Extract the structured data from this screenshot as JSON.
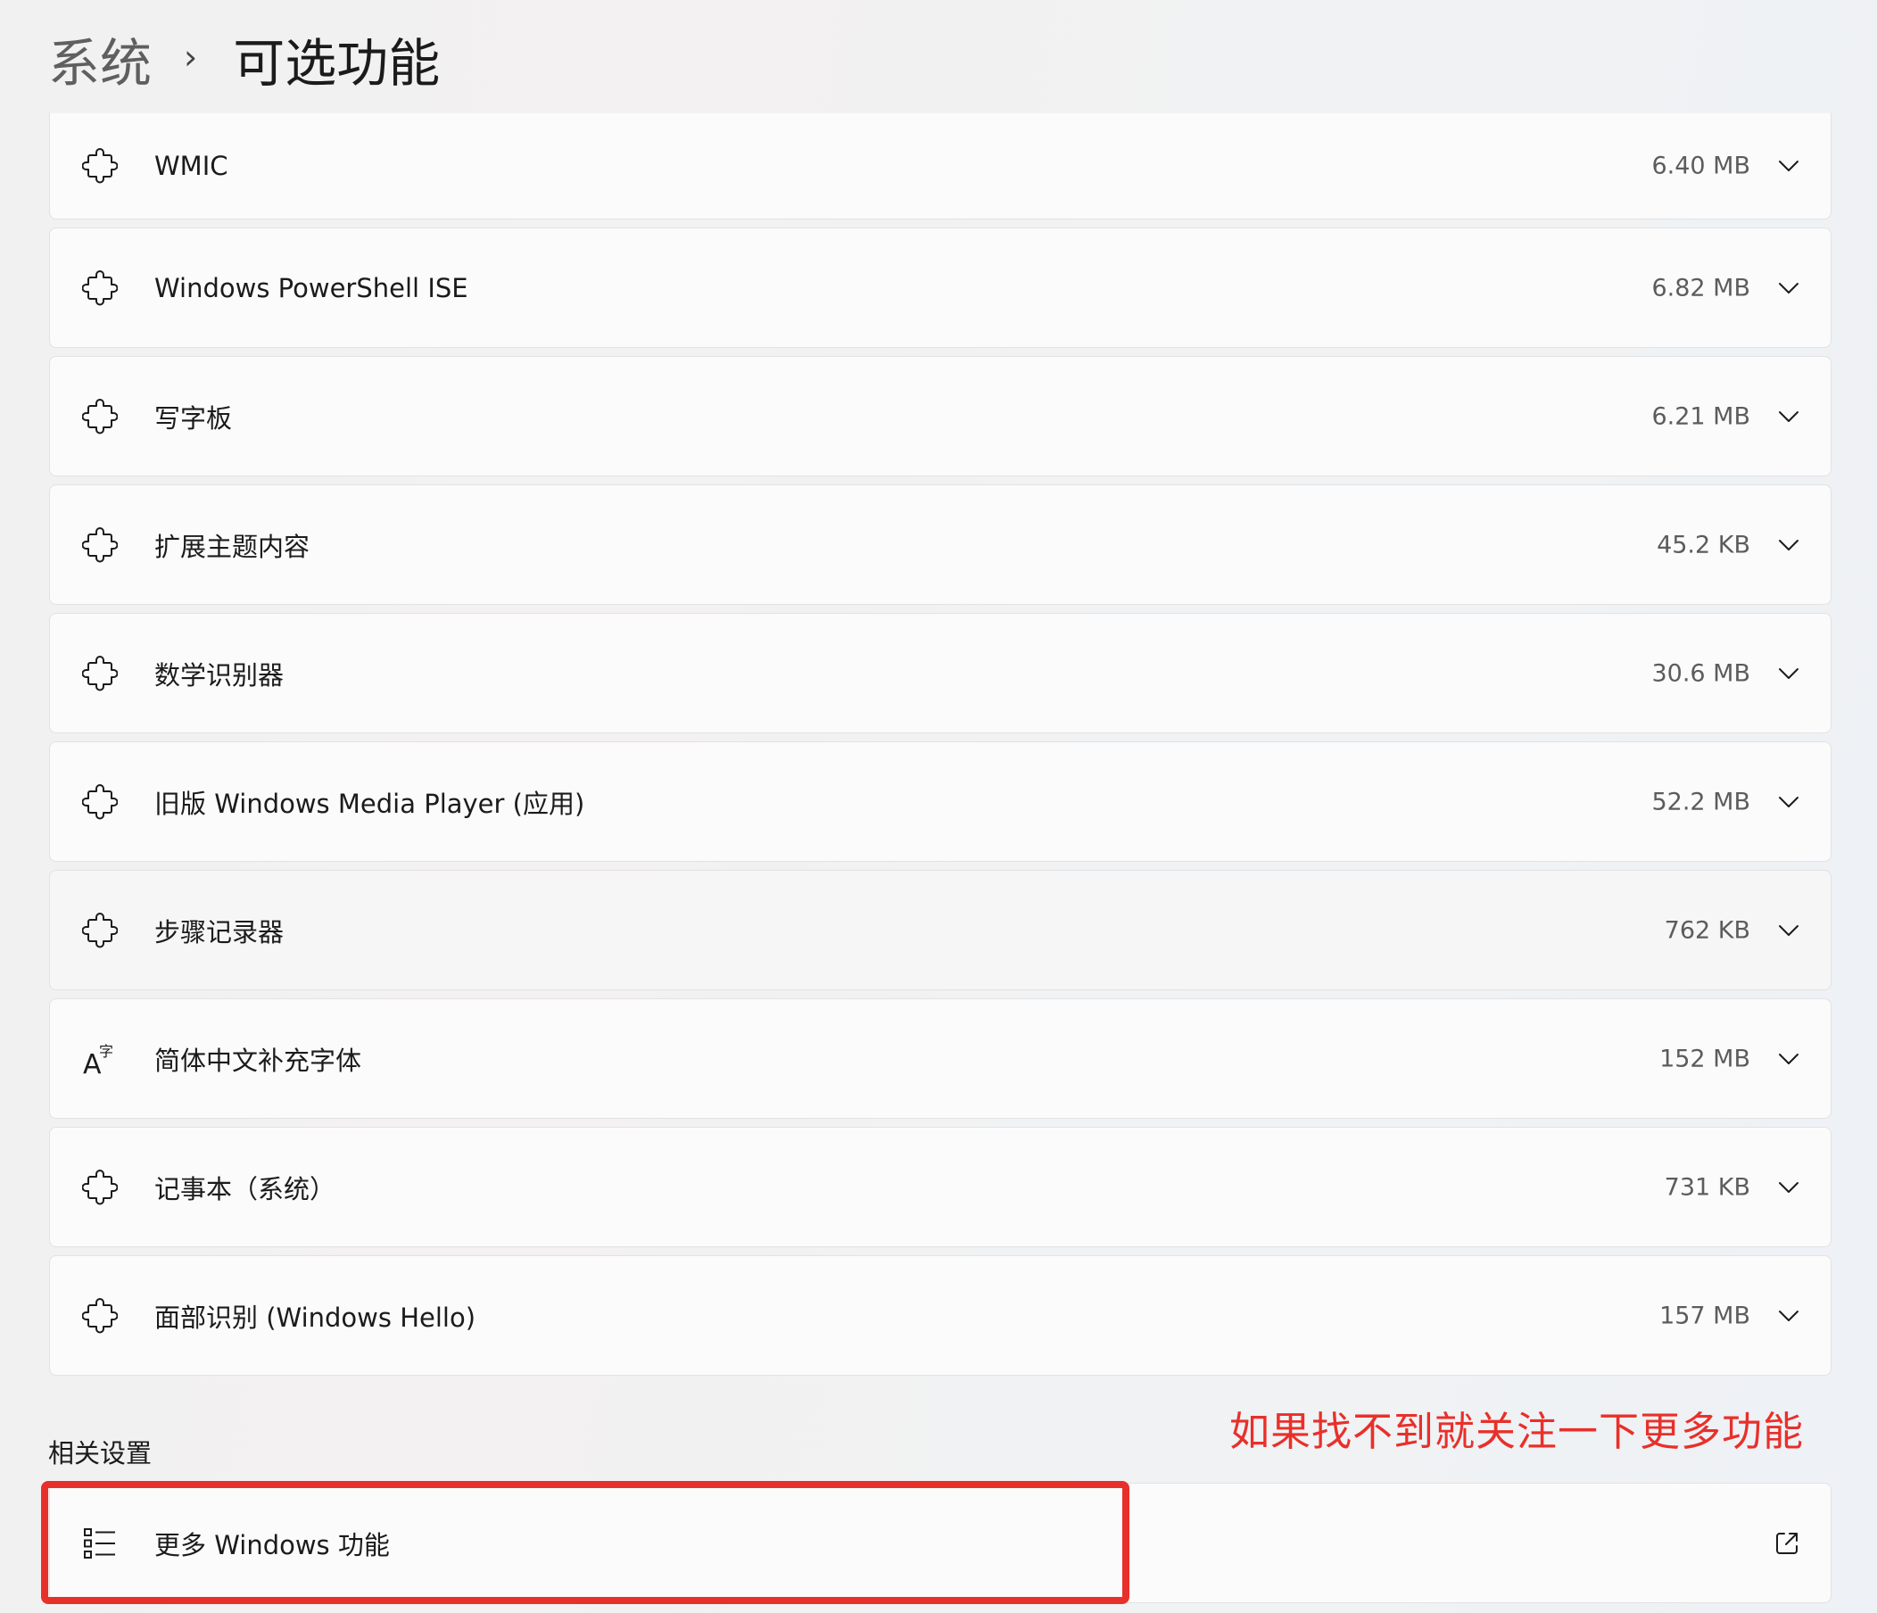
{
  "breadcrumb": {
    "parent": "系统",
    "separator": "›",
    "current": "可选功能"
  },
  "features": [
    {
      "name": "WMIC",
      "size": "6.40 MB",
      "icon": "puzzle-icon"
    },
    {
      "name": "Windows PowerShell ISE",
      "size": "6.82 MB",
      "icon": "puzzle-icon"
    },
    {
      "name": "写字板",
      "size": "6.21 MB",
      "icon": "puzzle-icon"
    },
    {
      "name": "扩展主题内容",
      "size": "45.2 KB",
      "icon": "puzzle-icon"
    },
    {
      "name": "数学识别器",
      "size": "30.6 MB",
      "icon": "puzzle-icon"
    },
    {
      "name": "旧版 Windows Media Player (应用)",
      "size": "52.2 MB",
      "icon": "puzzle-icon"
    },
    {
      "name": "步骤记录器",
      "size": "762 KB",
      "icon": "puzzle-icon"
    },
    {
      "name": "简体中文补充字体",
      "size": "152 MB",
      "icon": "font-icon"
    },
    {
      "name": "记事本（系统）",
      "size": "731 KB",
      "icon": "puzzle-icon"
    },
    {
      "name": "面部识别 (Windows Hello)",
      "size": "157 MB",
      "icon": "puzzle-icon"
    }
  ],
  "related": {
    "title": "相关设置",
    "more_features_label": "更多 Windows 功能",
    "more_features_icon": "list-icon",
    "external_icon": "open-external-icon"
  },
  "annotation": {
    "text": "如果找不到就关注一下更多功能",
    "color": "#e8302a"
  }
}
